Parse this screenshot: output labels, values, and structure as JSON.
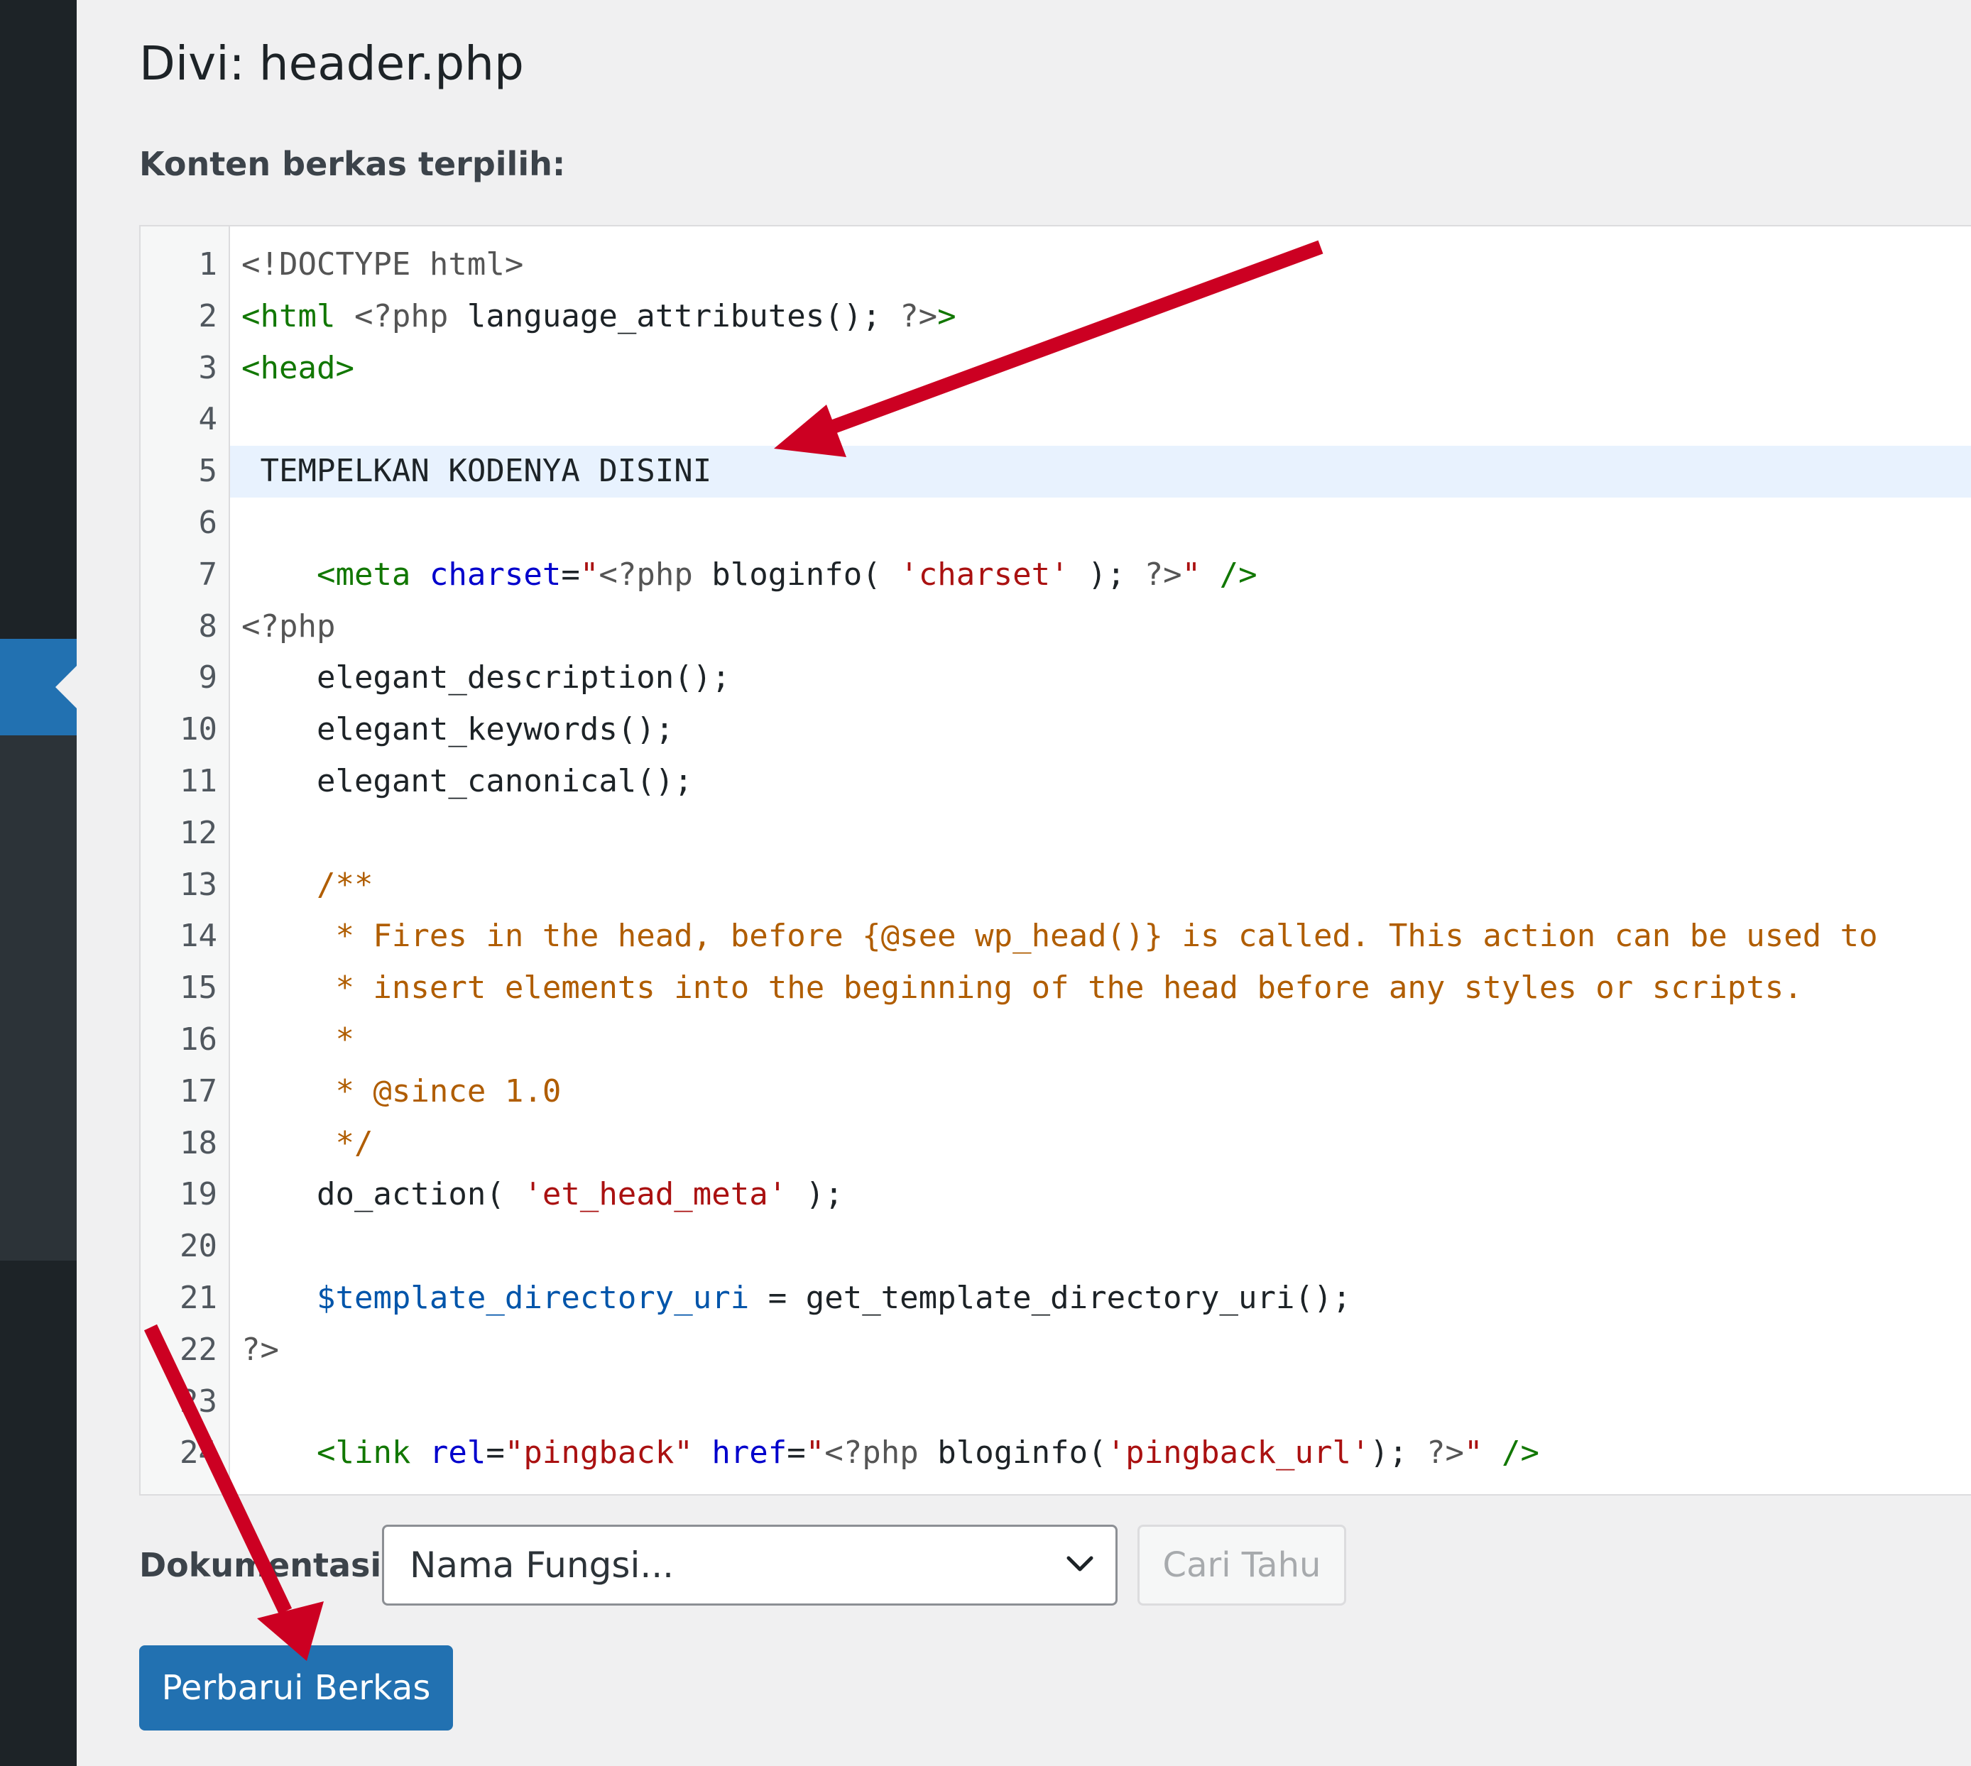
{
  "page": {
    "title_prefix": "Divi:",
    "title_file": "header.php",
    "subtitle": "Konten berkas terpilih:"
  },
  "editor": {
    "active_line": 5,
    "lines": [
      {
        "n": "1",
        "tokens": [
          [
            "meta",
            "<!DOCTYPE html>"
          ]
        ]
      },
      {
        "n": "2",
        "tokens": [
          [
            "tag",
            "<html"
          ],
          [
            "plain",
            " "
          ],
          [
            "meta",
            "<?php"
          ],
          [
            "plain",
            " language_attributes(); "
          ],
          [
            "meta",
            "?>"
          ],
          [
            "tag",
            ">"
          ]
        ]
      },
      {
        "n": "3",
        "tokens": [
          [
            "tag",
            "<head>"
          ]
        ]
      },
      {
        "n": "4",
        "tokens": []
      },
      {
        "n": "5",
        "tokens": [
          [
            "plain",
            " TEMPELKAN KODENYA DISINI"
          ]
        ]
      },
      {
        "n": "6",
        "tokens": []
      },
      {
        "n": "7",
        "tokens": [
          [
            "plain",
            "    "
          ],
          [
            "tag",
            "<meta"
          ],
          [
            "plain",
            " "
          ],
          [
            "attr",
            "charset"
          ],
          [
            "plain",
            "="
          ],
          [
            "str",
            "\""
          ],
          [
            "meta",
            "<?php"
          ],
          [
            "plain",
            " bloginfo( "
          ],
          [
            "str",
            "'charset'"
          ],
          [
            "plain",
            " ); "
          ],
          [
            "meta",
            "?>"
          ],
          [
            "str",
            "\""
          ],
          [
            "plain",
            " "
          ],
          [
            "tag",
            "/>"
          ]
        ]
      },
      {
        "n": "8",
        "tokens": [
          [
            "meta",
            "<?php"
          ]
        ]
      },
      {
        "n": "9",
        "tokens": [
          [
            "plain",
            "    elegant_description();"
          ]
        ]
      },
      {
        "n": "10",
        "tokens": [
          [
            "plain",
            "    elegant_keywords();"
          ]
        ]
      },
      {
        "n": "11",
        "tokens": [
          [
            "plain",
            "    elegant_canonical();"
          ]
        ]
      },
      {
        "n": "12",
        "tokens": []
      },
      {
        "n": "13",
        "tokens": [
          [
            "plain",
            "    "
          ],
          [
            "com",
            "/**"
          ]
        ]
      },
      {
        "n": "14",
        "tokens": [
          [
            "plain",
            "     "
          ],
          [
            "com",
            "* Fires in the head, before {@see wp_head()} is called. This action can be used to"
          ]
        ]
      },
      {
        "n": "15",
        "tokens": [
          [
            "plain",
            "     "
          ],
          [
            "com",
            "* insert elements into the beginning of the head before any styles or scripts."
          ]
        ]
      },
      {
        "n": "16",
        "tokens": [
          [
            "plain",
            "     "
          ],
          [
            "com",
            "*"
          ]
        ]
      },
      {
        "n": "17",
        "tokens": [
          [
            "plain",
            "     "
          ],
          [
            "com",
            "* @since 1.0"
          ]
        ]
      },
      {
        "n": "18",
        "tokens": [
          [
            "plain",
            "     "
          ],
          [
            "com",
            "*/"
          ]
        ]
      },
      {
        "n": "19",
        "tokens": [
          [
            "plain",
            "    do_action( "
          ],
          [
            "str",
            "'et_head_meta'"
          ],
          [
            "plain",
            " );"
          ]
        ]
      },
      {
        "n": "20",
        "tokens": []
      },
      {
        "n": "21",
        "tokens": [
          [
            "plain",
            "    "
          ],
          [
            "var",
            "$template_directory_uri"
          ],
          [
            "plain",
            " = get_template_directory_uri();"
          ]
        ]
      },
      {
        "n": "22",
        "tokens": [
          [
            "meta",
            "?>"
          ]
        ]
      },
      {
        "n": "23",
        "tokens": []
      },
      {
        "n": "24",
        "tokens": [
          [
            "plain",
            "    "
          ],
          [
            "tag",
            "<link"
          ],
          [
            "plain",
            " "
          ],
          [
            "attr",
            "rel"
          ],
          [
            "plain",
            "="
          ],
          [
            "str",
            "\"pingback\""
          ],
          [
            "plain",
            " "
          ],
          [
            "attr",
            "href"
          ],
          [
            "plain",
            "="
          ],
          [
            "str",
            "\""
          ],
          [
            "meta",
            "<?php"
          ],
          [
            "plain",
            " bloginfo("
          ],
          [
            "str",
            "'pingback_url'"
          ],
          [
            "plain",
            "); "
          ],
          [
            "meta",
            "?>"
          ],
          [
            "str",
            "\""
          ],
          [
            "plain",
            " "
          ],
          [
            "tag",
            "/>"
          ]
        ]
      }
    ]
  },
  "docs": {
    "label": "Dokumentasi:",
    "select_value": "Nama Fungsi...",
    "lookup_button": "Cari Tahu"
  },
  "actions": {
    "update_button": "Perbarui Berkas"
  },
  "icons": {
    "select_arrow": "chevron-down-icon",
    "annotation_arrows": "red-arrow-icon"
  },
  "colors": {
    "accent": "#2271b1",
    "sidebar": "#1d2327",
    "annotation": "#cc0022"
  }
}
